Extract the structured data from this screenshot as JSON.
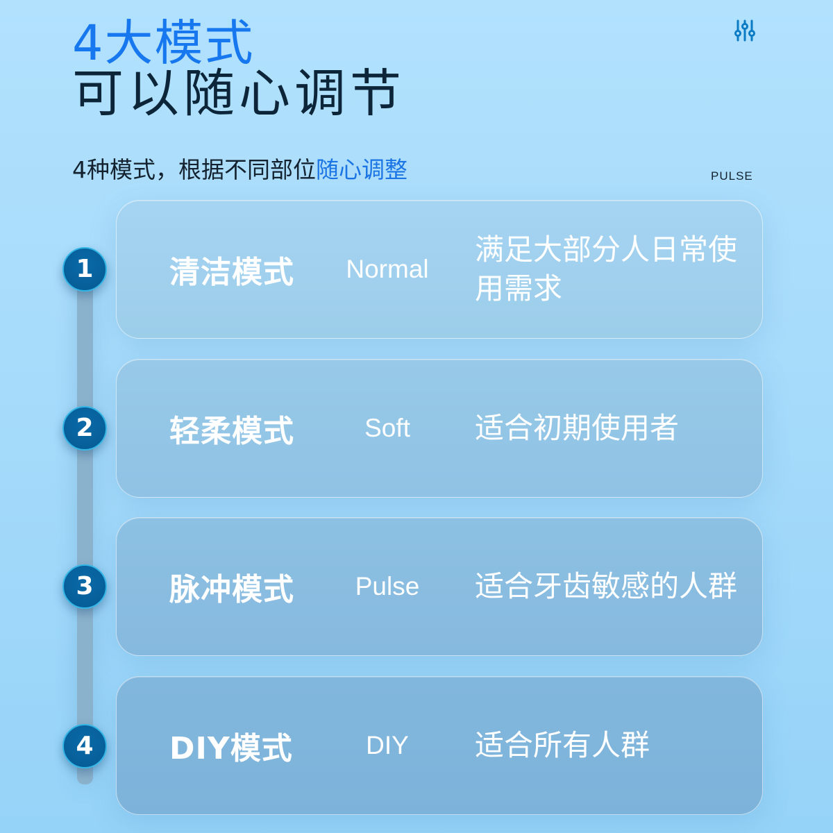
{
  "header": {
    "title_accent": "4大模式",
    "title_main": "可以随心调节",
    "subtitle_plain": "4种模式，根据不同部位",
    "subtitle_highlight": "随心调整",
    "tag": "PULSE",
    "icon": "sliders-icon"
  },
  "colors": {
    "accent": "#1677ee",
    "title_dark": "#0d2538",
    "badge": "#0662a0",
    "track": "#8bb2cc"
  },
  "modes": [
    {
      "number": "1",
      "name": "清洁模式",
      "english": "Normal",
      "description": "满足大部分人日常使用需求"
    },
    {
      "number": "2",
      "name": "轻柔模式",
      "english": "Soft",
      "description": "适合初期使用者"
    },
    {
      "number": "3",
      "name": "脉冲模式",
      "english": "Pulse",
      "description": "适合牙齿敏感的人群"
    },
    {
      "number": "4",
      "name": "DIY模式",
      "english": "DIY",
      "description": "适合所有人群"
    }
  ]
}
